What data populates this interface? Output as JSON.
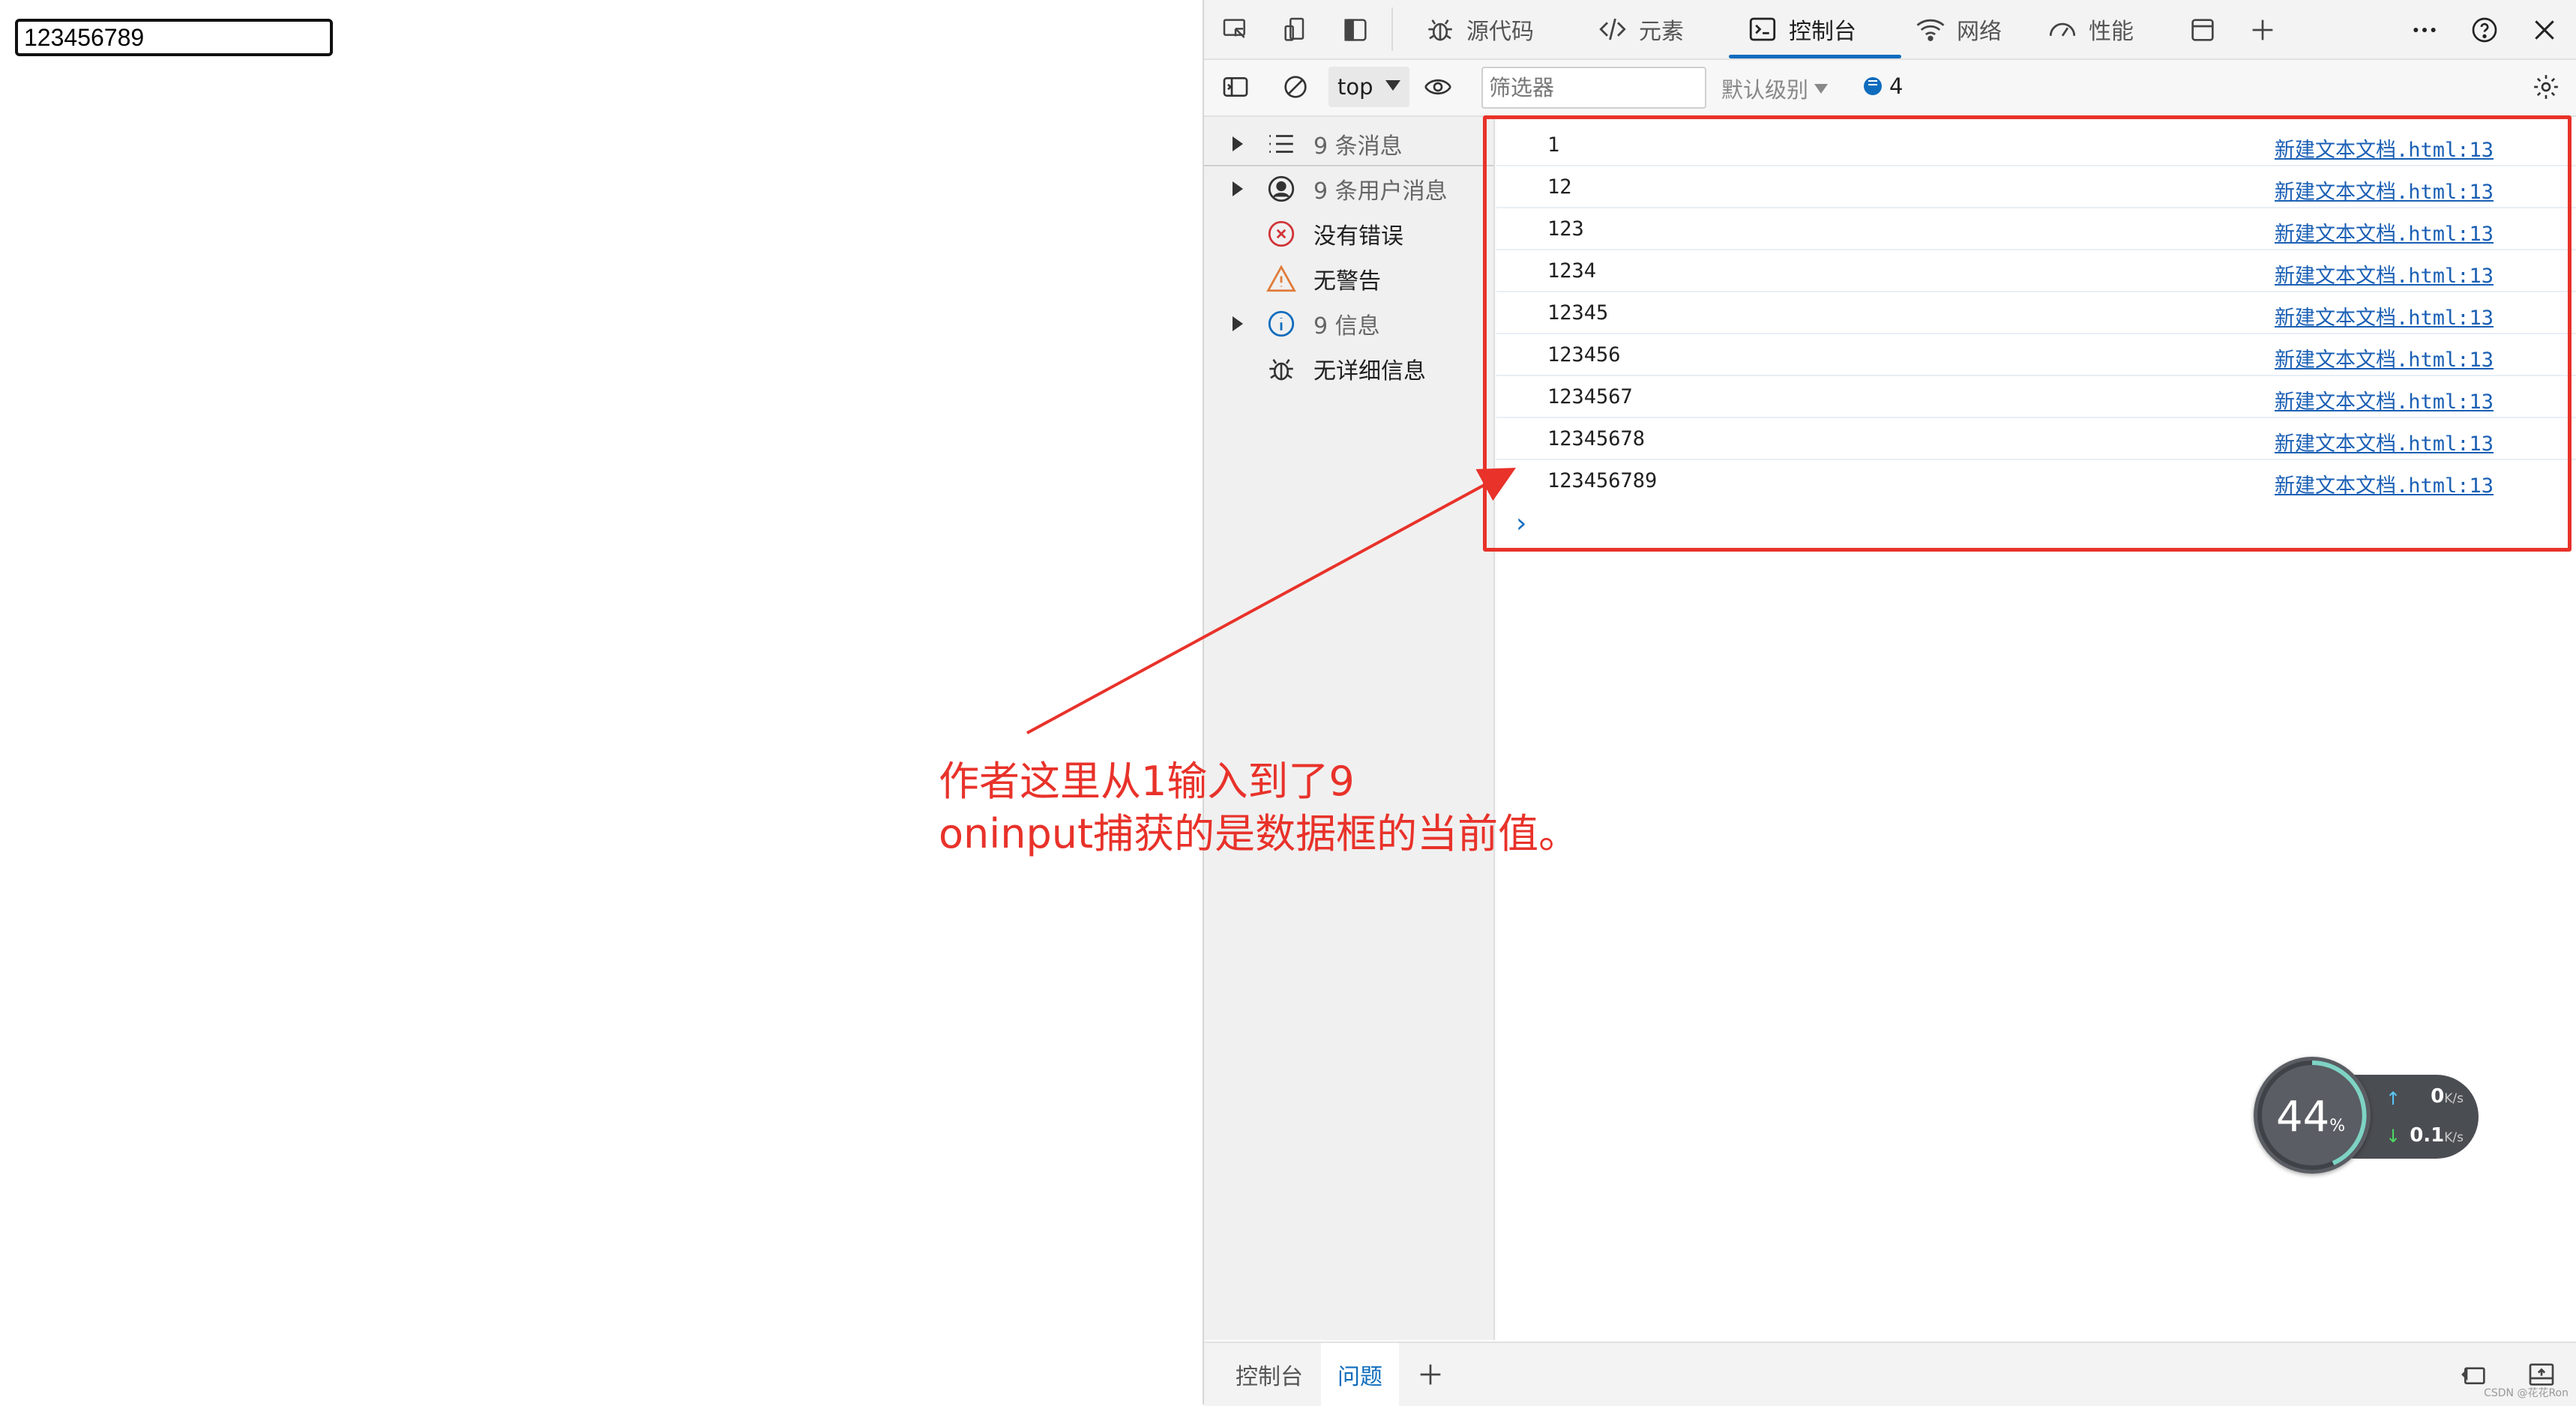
{
  "page": {
    "input_value": "123456789"
  },
  "devtools": {
    "tabs": [
      {
        "label": "源代码",
        "icon": "bug-icon"
      },
      {
        "label": "元素",
        "icon": "code-tag-icon"
      },
      {
        "label": "控制台",
        "icon": "console-icon",
        "active": true
      },
      {
        "label": "网络",
        "icon": "wifi-icon"
      },
      {
        "label": "性能",
        "icon": "performance-icon"
      }
    ],
    "toolbar": {
      "context": "top",
      "filter_placeholder": "筛选器",
      "level_label": "默认级别",
      "message_count": "4"
    },
    "sidebar": [
      {
        "label": "9 条消息",
        "icon": "list-icon",
        "expandable": true,
        "muted": true
      },
      {
        "label": "9 条用户消息",
        "icon": "user-icon",
        "expandable": true,
        "muted": true
      },
      {
        "label": "没有错误",
        "icon": "error-icon",
        "expandable": false,
        "muted": false
      },
      {
        "label": "无警告",
        "icon": "warning-icon",
        "expandable": false,
        "muted": false
      },
      {
        "label": "9 信息",
        "icon": "info-icon",
        "expandable": true,
        "muted": true
      },
      {
        "label": "无详细信息",
        "icon": "verbose-bug-icon",
        "expandable": false,
        "muted": false
      }
    ],
    "console_logs": [
      {
        "value": "1",
        "source": "新建文本文档.html:13"
      },
      {
        "value": "12",
        "source": "新建文本文档.html:13"
      },
      {
        "value": "123",
        "source": "新建文本文档.html:13"
      },
      {
        "value": "1234",
        "source": "新建文本文档.html:13"
      },
      {
        "value": "12345",
        "source": "新建文本文档.html:13"
      },
      {
        "value": "123456",
        "source": "新建文本文档.html:13"
      },
      {
        "value": "1234567",
        "source": "新建文本文档.html:13"
      },
      {
        "value": "12345678",
        "source": "新建文本文档.html:13"
      },
      {
        "value": "123456789",
        "source": "新建文本文档.html:13"
      }
    ],
    "drawer_tabs": [
      {
        "label": "控制台",
        "active": false
      },
      {
        "label": "问题",
        "active": true
      }
    ]
  },
  "annotation": {
    "line1": "作者这里从1输入到了9",
    "line2": "oninput捕获的是数据框的当前值。",
    "color": "#e8322a"
  },
  "speed_widget": {
    "percent": "44",
    "percent_unit": "%",
    "upload_value": "0",
    "download_value": "0.1",
    "unit": "K/s"
  },
  "watermark": "CSDN @花花Ron"
}
